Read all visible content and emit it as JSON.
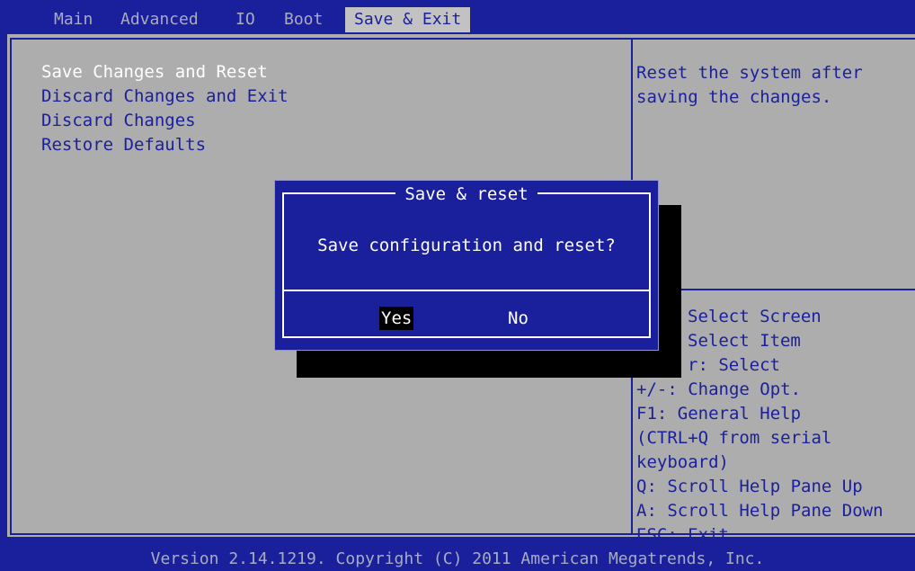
{
  "tabs": [
    "Main",
    "Advanced",
    "IO",
    "Boot",
    "Save & Exit"
  ],
  "active_tab": "Save & Exit",
  "menu": [
    "Save Changes and Reset",
    "Discard Changes and Exit",
    "Discard Changes",
    "Restore Defaults"
  ],
  "help": {
    "line1": "Reset the system after",
    "line2": "saving the changes."
  },
  "keys": [
    "Select Screen",
    "Select Item",
    "r: Select",
    "+/-: Change Opt.",
    "F1: General Help",
    "(CTRL+Q from serial",
    "keyboard)",
    "Q: Scroll Help Pane Up",
    "A: Scroll Help Pane Down",
    "ESC: Exit"
  ],
  "dialog": {
    "title": "Save & reset",
    "message": "Save configuration and reset?",
    "yes": "Yes",
    "no": "No"
  },
  "footer": "Version 2.14.1219. Copyright (C) 2011 American Megatrends, Inc.",
  "colors": {
    "background_blue": "#1a1f9c",
    "panel_gray": "#adadad",
    "highlight_white": "#ffffff",
    "selection_black": "#000000"
  }
}
